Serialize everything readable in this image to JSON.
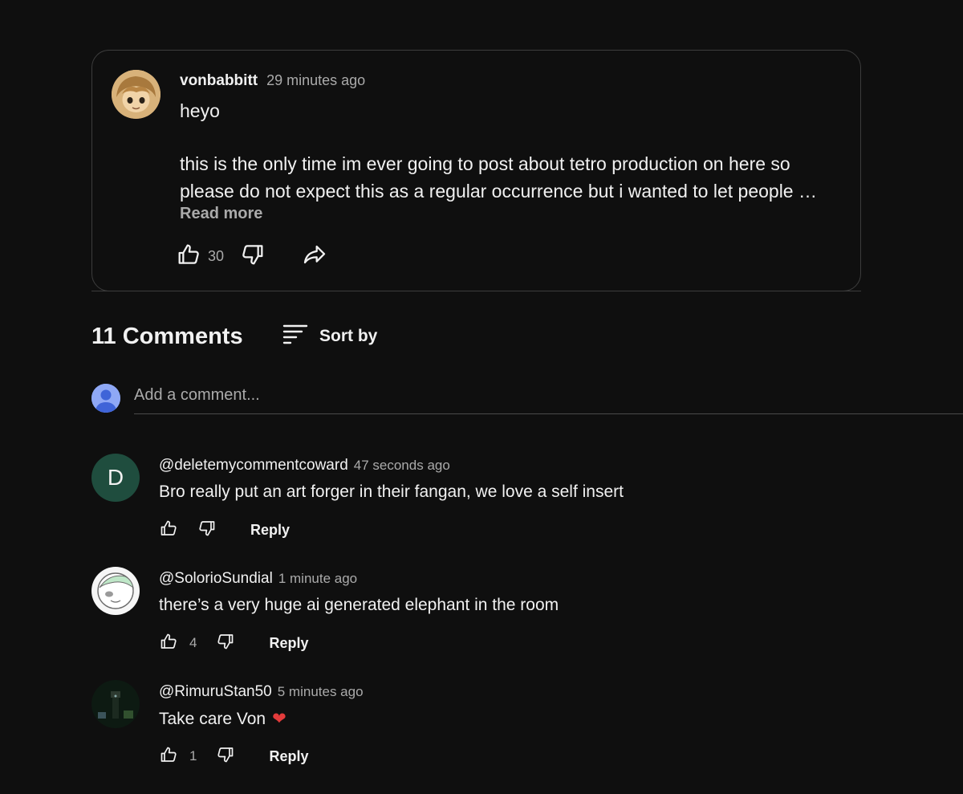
{
  "post": {
    "author": "vonbabbitt",
    "time": "29 minutes ago",
    "line1": "heyo",
    "line2": "this is the only time im ever going to post about tetro production on here so",
    "line3": "please do not expect this as a regular occurrence but i wanted to let people …",
    "read_more": "Read more",
    "likes": "30"
  },
  "comments_header": {
    "title": "11 Comments",
    "sort_label": "Sort by"
  },
  "add_comment": {
    "placeholder": "Add a comment..."
  },
  "comments": [
    {
      "avatar_letter": "D",
      "author": "@deletemycommentcoward",
      "time": "47 seconds ago",
      "text": "Bro really put an art forger in their fangan, we love a self insert",
      "likes": "",
      "reply": "Reply"
    },
    {
      "author": "@SolorioSundial",
      "time": "1 minute ago",
      "text": "there’s a very huge ai generated elephant in the room",
      "likes": "4",
      "reply": "Reply"
    },
    {
      "author": "@RimuruStan50",
      "time": "5 minutes ago",
      "text": "Take care Von",
      "emoji": "❤",
      "likes": "1",
      "reply": "Reply"
    }
  ],
  "colors": {
    "background": "#0f0f0f",
    "card_border": "#3d3d3d",
    "secondary_text": "#aaaaaa",
    "heart": "#e33b3b"
  }
}
